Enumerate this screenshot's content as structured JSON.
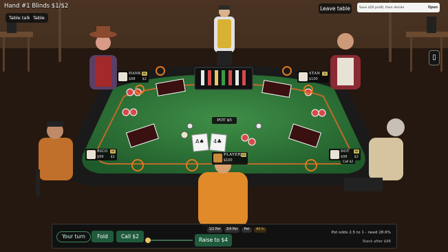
{
  "hud": {
    "hand_info": "Hand #1 Blinds $1/$2",
    "table_talk": "Table talk",
    "table": "Table",
    "leave_table": "Leave table",
    "tip_text": "Save $50 profit, then decide",
    "tip_open": "Open",
    "phone_icon": "phone-icon"
  },
  "seats": {
    "hank": {
      "name": "HANK",
      "stack": "$98",
      "bet": "$2",
      "badge": "BB"
    },
    "stan": {
      "name": "STAN",
      "stack": "$100",
      "badge": "D"
    },
    "rico": {
      "name": "RICO",
      "stack": "$99",
      "bet": "$1",
      "badge": "SB"
    },
    "dot": {
      "name": "DOT",
      "stack": "$98",
      "bet": "$2",
      "sub": "Call $2",
      "badge": "BB"
    },
    "player": {
      "name": "PLAYER",
      "stack": "$100",
      "badge": "YOU"
    }
  },
  "table": {
    "pot": "POT $5",
    "player_cards": [
      "A♠",
      "4♣"
    ],
    "felt_color": "#2f7a3a",
    "rail_color": "#1a1a1a"
  },
  "actions": {
    "your_turn": "Your turn",
    "fold": "Fold",
    "call": "Call $2",
    "presets": [
      "1/2 Pot",
      "3/4 Pot",
      "Pot",
      "All in"
    ],
    "raise": "Raise to $4",
    "pot_odds": "Pot odds 2.5 to 1 - need 28.6%",
    "stack_after": "Stack after $96",
    "raise_fraction": 0.0
  }
}
